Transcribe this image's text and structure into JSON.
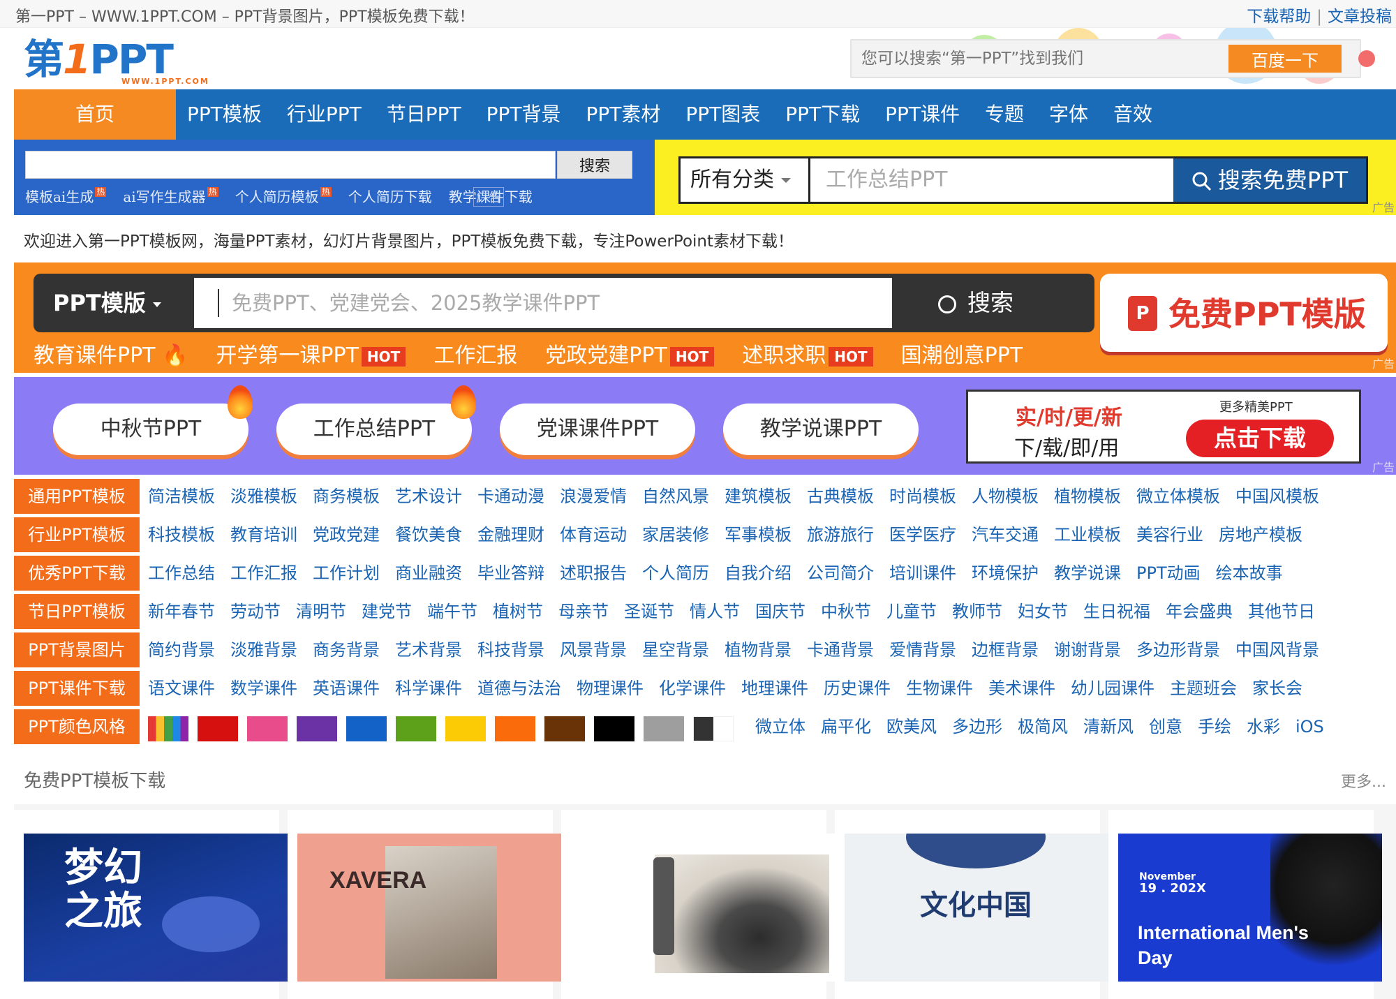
{
  "topbar": {
    "site_title": "第一PPT – WWW.1PPT.COM – PPT背景图片，PPT模板免费下载！",
    "links": [
      "下载帮助",
      "文章投稿"
    ]
  },
  "header": {
    "logo_text_a": "第",
    "logo_text_one": "1",
    "logo_text_b": "PPT",
    "logo_sub": "WWW.1PPT.COM",
    "search_placeholder": "您可以搜索“第一PPT”找到我们",
    "search_button": "百度一下"
  },
  "nav": {
    "home": "首页",
    "items": [
      "PPT模板",
      "行业PPT",
      "节日PPT",
      "PPT背景",
      "PPT素材",
      "PPT图表",
      "PPT下载",
      "PPT课件",
      "专题",
      "字体",
      "音效"
    ]
  },
  "blue_ad": {
    "search_button": "搜索",
    "hot_links": [
      "模板ai生成",
      "ai写作生成器",
      "个人简历模板",
      "个人简历下载",
      "教学课件下载"
    ],
    "hot_badge": "热",
    "ad_label": "广告"
  },
  "yellow_ad": {
    "category": "所有分类",
    "keyword": "工作总结PPT",
    "button": "搜索免费PPT",
    "ad_label": "广告"
  },
  "welcome": "欢迎进入第一PPT模板网，海量PPT素材，幻灯片背景图片，PPT模板免费下载，专注PowerPoint素材下载！",
  "orange_ad": {
    "label": "PPT模版",
    "placeholder": "免费PPT、党建党会、2025教学课件PPT",
    "button": "搜索",
    "free_icon": "P",
    "free_text": "免费PPT模版",
    "tags": [
      {
        "text": "教育课件PPT",
        "badge": ""
      },
      {
        "text": "开学第一课PPT",
        "badge": "HOT"
      },
      {
        "text": "工作汇报",
        "badge": ""
      },
      {
        "text": "党政党建PPT",
        "badge": "HOT"
      },
      {
        "text": "述职求职",
        "badge": "HOT"
      },
      {
        "text": "国潮创意PPT",
        "badge": ""
      }
    ],
    "ad_label": "广告"
  },
  "purple_ad": {
    "pills": [
      "中秋节PPT",
      "工作总结PPT",
      "党课课件PPT",
      "教学说课PPT"
    ],
    "line1": "实/时/更/新",
    "line2": "下/载/即/用",
    "more": "更多精美PPT",
    "button": "点击下载",
    "ad_label": "广告"
  },
  "categories": [
    {
      "label": "通用PPT模板",
      "links": [
        "简洁模板",
        "淡雅模板",
        "商务模板",
        "艺术设计",
        "卡通动漫",
        "浪漫爱情",
        "自然风景",
        "建筑模板",
        "古典模板",
        "时尚模板",
        "人物模板",
        "植物模板",
        "微立体模板",
        "中国风模板"
      ]
    },
    {
      "label": "行业PPT模板",
      "links": [
        "科技模板",
        "教育培训",
        "党政党建",
        "餐饮美食",
        "金融理财",
        "体育运动",
        "家居装修",
        "军事模板",
        "旅游旅行",
        "医学医疗",
        "汽车交通",
        "工业模板",
        "美容行业",
        "房地产模板"
      ]
    },
    {
      "label": "优秀PPT下载",
      "links": [
        "工作总结",
        "工作汇报",
        "工作计划",
        "商业融资",
        "毕业答辩",
        "述职报告",
        "个人简历",
        "自我介绍",
        "公司简介",
        "培训课件",
        "环境保护",
        "教学说课",
        "PPT动画",
        "绘本故事"
      ]
    },
    {
      "label": "节日PPT模板",
      "links": [
        "新年春节",
        "劳动节",
        "清明节",
        "建党节",
        "端午节",
        "植树节",
        "母亲节",
        "圣诞节",
        "情人节",
        "国庆节",
        "中秋节",
        "儿童节",
        "教师节",
        "妇女节",
        "生日祝福",
        "年会盛典",
        "其他节日"
      ]
    },
    {
      "label": "PPT背景图片",
      "links": [
        "简约背景",
        "淡雅背景",
        "商务背景",
        "艺术背景",
        "科技背景",
        "风景背景",
        "星空背景",
        "植物背景",
        "卡通背景",
        "爱情背景",
        "边框背景",
        "谢谢背景",
        "多边形背景",
        "中国风背景"
      ]
    },
    {
      "label": "PPT课件下载",
      "links": [
        "语文课件",
        "数学课件",
        "英语课件",
        "科学课件",
        "道德与法治",
        "物理课件",
        "化学课件",
        "地理课件",
        "历史课件",
        "生物课件",
        "美术课件",
        "幼儿园课件",
        "主题班会",
        "家长会"
      ]
    }
  ],
  "colors_row": {
    "label": "PPT颜色风格",
    "swatches": [
      "#d60f0f",
      "#e94c8a",
      "#6b32a6",
      "#1262c7",
      "#5da11b",
      "#fccb05",
      "#f96b0b",
      "#6a3307",
      "#000000",
      "#9e9e9e"
    ],
    "styles": [
      "微立体",
      "扁平化",
      "欧美风",
      "多边形",
      "极简风",
      "清新风",
      "创意",
      "手绘",
      "水彩",
      "iOS"
    ]
  },
  "free_section": {
    "title": "免费PPT模板下载",
    "more": "更多..."
  },
  "thumbs": {
    "t1": "梦幻之旅",
    "t2": "XAVERA",
    "t4": "文化中国",
    "t5_date": "November",
    "t5_year": "19 . 202X",
    "t5_title": "International Men's Day"
  }
}
